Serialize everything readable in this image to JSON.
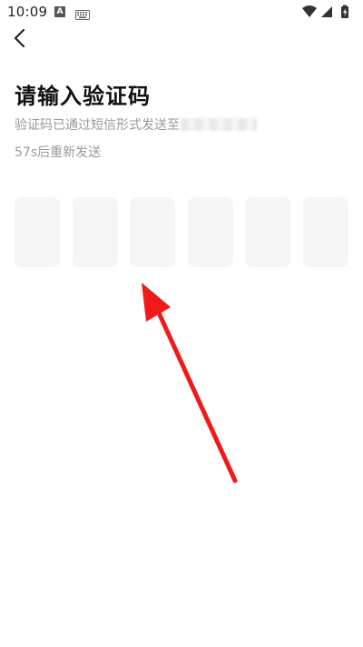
{
  "status_bar": {
    "time": "10:09",
    "notification_icon": "A",
    "icons": [
      "keyboard-icon",
      "wifi-icon",
      "signal-icon",
      "battery-icon"
    ]
  },
  "header": {
    "back_icon": "chevron-left-icon"
  },
  "main": {
    "title": "请输入验证码",
    "subtitle": "验证码已通过短信形式发送至",
    "resend_text": "57s后重新发送",
    "code_box_count": 6
  },
  "annotation": {
    "arrow_color": "#f01a1a"
  }
}
